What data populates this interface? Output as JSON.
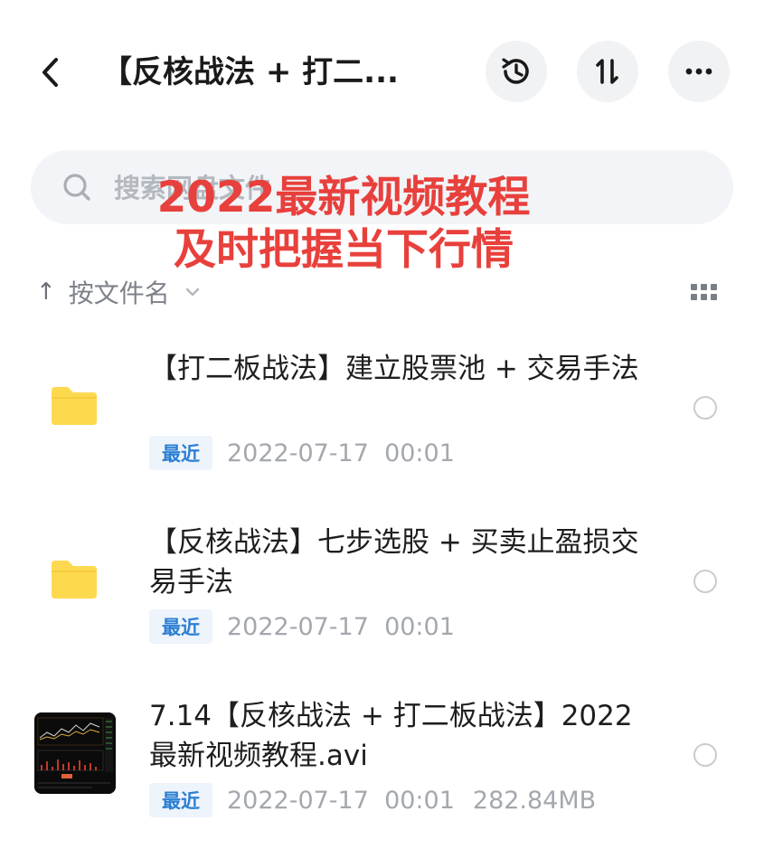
{
  "header": {
    "title": "【反核战法 + 打二...",
    "back_icon": "chevron-left-icon",
    "history_icon": "history-icon",
    "sort_icon": "sort-icon",
    "more_icon": "more-icon"
  },
  "search": {
    "placeholder": "搜索网盘文件"
  },
  "promo": {
    "line1": "2022最新视频教程",
    "line2": "及时把握当下行情"
  },
  "sort": {
    "arrow": "↑",
    "label": "按文件名"
  },
  "files": [
    {
      "name": "【打二板战法】建立股票池 + 交易手法",
      "badge": "最近",
      "date": "2022-07-17  00:01",
      "size": "",
      "type": "folder-icon"
    },
    {
      "name": "【反核战法】七步选股 + 买卖止盈损交易手法",
      "badge": "最近",
      "date": "2022-07-17  00:01",
      "size": "",
      "type": "folder-icon"
    },
    {
      "name": "7.14【反核战法 + 打二板战法】2022最新视频教程.avi",
      "badge": "最近",
      "date": "2022-07-17  00:01",
      "size": "282.84MB",
      "type": "video-thumbnail"
    }
  ],
  "colors": {
    "accent": "#2b7fd4",
    "promo": "#e8403c",
    "folder": "#fdd94f"
  }
}
